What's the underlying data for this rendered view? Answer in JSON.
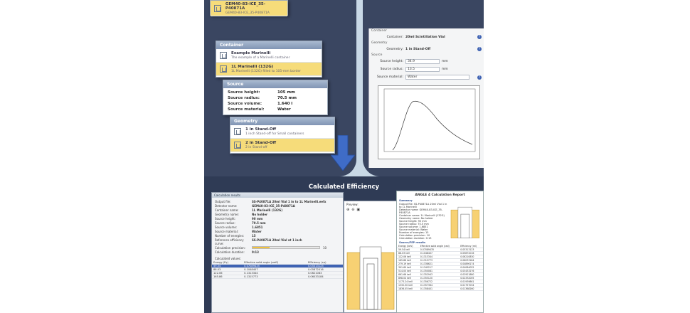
{
  "top_left": {
    "top_partial_row": {
      "title": "GEM40-83-ICE_35-P40871A",
      "sub": "GEM40-83-ICE_35-P40871A"
    },
    "container_card": {
      "header": "Container",
      "items": [
        {
          "title": "Example Marinelli",
          "sub": "The example of a Marinelli container",
          "selected": false
        },
        {
          "title": "1L Marinelli (132G)",
          "sub": "1L Marinelli (132G) filled to 105-mm border",
          "selected": true
        }
      ]
    },
    "source_card": {
      "header": "Source",
      "rows": [
        {
          "k": "Source height:",
          "v": "105 mm"
        },
        {
          "k": "Source radius:",
          "v": "70.5 mm"
        },
        {
          "k": "Source volume:",
          "v": "1.640 l"
        },
        {
          "k": "Source material:",
          "v": "Water"
        }
      ]
    },
    "geometry_card": {
      "header": "Geometry",
      "items": [
        {
          "title": "1 in Stand-Off",
          "sub": "1 inch Stand-off for Small containers",
          "selected": false
        },
        {
          "title": "2 in Stand-Off",
          "sub": "2 in Stand-off",
          "selected": true
        }
      ]
    }
  },
  "top_right": {
    "container_section": "Container",
    "container_label": "Container:",
    "container_value": "20ml Scintillation Vial",
    "geometry_section": "Geometry",
    "geometry_label": "Geometry:",
    "geometry_value": "1 in Stand-Off",
    "source_section": "Source",
    "source_height_label": "Source height:",
    "source_height_value": "34.9",
    "source_height_unit": "mm",
    "source_radius_label": "Source radius:",
    "source_radius_value": "13.5",
    "source_radius_unit": "mm",
    "source_material_label": "Source material:",
    "source_material_value": "Water"
  },
  "banner": {
    "title": "Calculated Efficiency"
  },
  "calc_window": {
    "title": "Calculation results",
    "rows": [
      {
        "k": "Output file:",
        "v": "SS-P40871A 20ml Vial 1 in to 1L Marinelli.eefx"
      },
      {
        "k": "Detector name:",
        "v": "GEM40-83-ICE_35-P40871A"
      },
      {
        "k": "Container name:",
        "v": "1L Marinelli (132G)"
      },
      {
        "k": "Geometry name:",
        "v": "No holder"
      },
      {
        "k": "Source height:",
        "v": "90 mm"
      },
      {
        "k": "Source radius:",
        "v": "70.5 mm"
      },
      {
        "k": "Source volume:",
        "v": "1.6851"
      },
      {
        "k": "Source material:",
        "v": "Water"
      },
      {
        "k": "Number of energies:",
        "v": "15"
      },
      {
        "k": "Reference efficiency curve:",
        "v": "SS-P40871A 20ml Vial at 1 inch"
      },
      {
        "k": "Calculation precision:",
        "v": ""
      },
      {
        "k": "Calculation duration:",
        "v": "0:13"
      }
    ],
    "precision_value": "10",
    "table_label": "Calculated values:",
    "table_headers": [
      "Energy (Eγ)",
      "Effective solid angle (ωeff)",
      "Efficiency (εp)"
    ],
    "table_rows": [
      [
        "59.54",
        "0.07089435",
        "0.05313123"
      ],
      [
        "88.03",
        "0.1048407",
        "0.05872016"
      ],
      [
        "122.06",
        "0.1313344",
        "0.0621083"
      ],
      [
        "165.86",
        "0.1315773",
        "0.06033184"
      ]
    ],
    "preview_label": "Preview:"
  },
  "report": {
    "title": "ANGLE 4 Calculation Report",
    "summary_label": "Summary",
    "summary_lines": [
      "Output file: SS-P40871A 20ml Vial 1 in to 1L Marinelli",
      "Detector name: GEM40-83-ICE_35-P40871A",
      "Container name: 1L Marinelli (132G)",
      "Geometry name: No holder",
      "Source height: 90 mm",
      "Source radius: 70.5 mm",
      "Source volume: 1.6851",
      "Source material: Water",
      "Number of energies: 15",
      "Calculation precision: 10",
      "Calculation duration: 0:13"
    ],
    "results_label": "Source/FEP results",
    "results_headers": [
      "Energy (keV)",
      "Effective solid angle (rad)",
      "Efficiency (rel)"
    ],
    "results_rows": [
      [
        "59.54 keV",
        "0.07089435",
        "0.05313123"
      ],
      [
        "88.03 keV",
        "0.1048407",
        "0.05872016"
      ],
      [
        "122.06 keV",
        "0.1313344",
        "0.06210830"
      ],
      [
        "165.86 keV",
        "0.1315773",
        "0.06033184"
      ],
      [
        "279.19 keV",
        "0.1338621",
        "0.04896174"
      ],
      [
        "391.69 keV",
        "0.1345217",
        "0.04084052"
      ],
      [
        "514.00 keV",
        "0.1350081",
        "0.03433276"
      ],
      [
        "661.66 keV",
        "0.1352943",
        "0.02921880"
      ],
      [
        "898.04 keV",
        "0.1355120",
        "0.02332005"
      ],
      [
        "1173.24 keV",
        "0.1356722",
        "0.01939861"
      ],
      [
        "1332.50 keV",
        "0.1357364",
        "0.01757034"
      ],
      [
        "1836.05 keV",
        "0.1358401",
        "0.01368260"
      ]
    ]
  },
  "colors": {
    "dark_bg": "#2f3b55",
    "frame": "#c9d9e6",
    "highlight": "#f6dc7a",
    "accent_blue": "#3e62b3"
  },
  "icons": [
    "container-icon",
    "geometry-icon",
    "help-icon",
    "down-arrow-icon",
    "zoom-in-icon",
    "zoom-out-icon",
    "save-icon"
  ]
}
